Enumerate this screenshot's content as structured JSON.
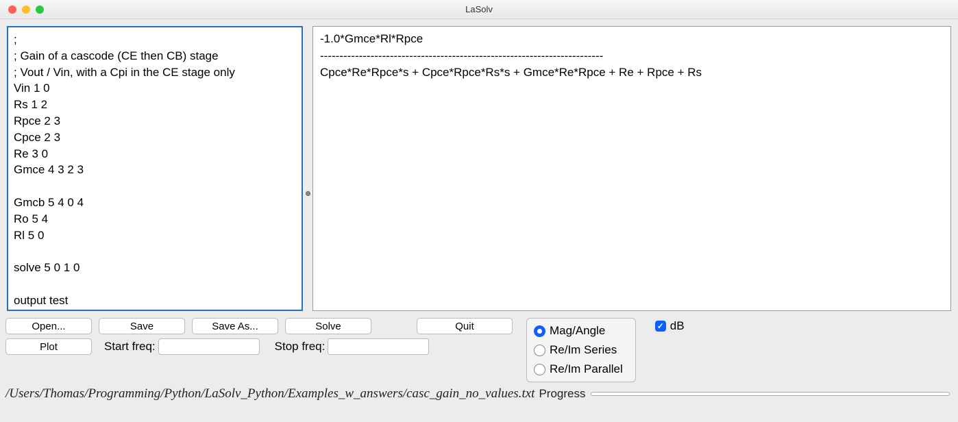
{
  "window": {
    "title": "LaSolv"
  },
  "editor": {
    "content": ";\n; Gain of a cascode (CE then CB) stage\n; Vout / Vin, with a Cpi in the CE stage only\nVin 1 0\nRs 1 2\nRpce 2 3\nCpce 2 3\nRe 3 0\nGmce 4 3 2 3\n\nGmcb 5 4 0 4\nRo 5 4\nRl 5 0\n\nsolve 5 0 1 0\n\noutput test"
  },
  "output": {
    "content": "-1.0*Gmce*Rl*Rpce\n-------------------------------------------------------------------------\nCpce*Re*Rpce*s + Cpce*Rpce*Rs*s + Gmce*Re*Rpce + Re + Rpce + Rs"
  },
  "buttons": {
    "open": "Open...",
    "save": "Save",
    "save_as": "Save As...",
    "solve": "Solve",
    "quit": "Quit",
    "plot": "Plot"
  },
  "freq": {
    "start_label": "Start freq:",
    "start_value": "",
    "stop_label": "Stop freq:",
    "stop_value": ""
  },
  "radios": {
    "mag_angle": "Mag/Angle",
    "re_im_series": "Re/Im Series",
    "re_im_parallel": "Re/Im Parallel",
    "selected": "mag_angle"
  },
  "checkbox": {
    "db_label": "dB",
    "db_checked": true
  },
  "status": {
    "path": "/Users/Thomas/Programming/Python/LaSolv_Python/Examples_w_answers/casc_gain_no_values.txt",
    "progress_label": "Progress"
  }
}
